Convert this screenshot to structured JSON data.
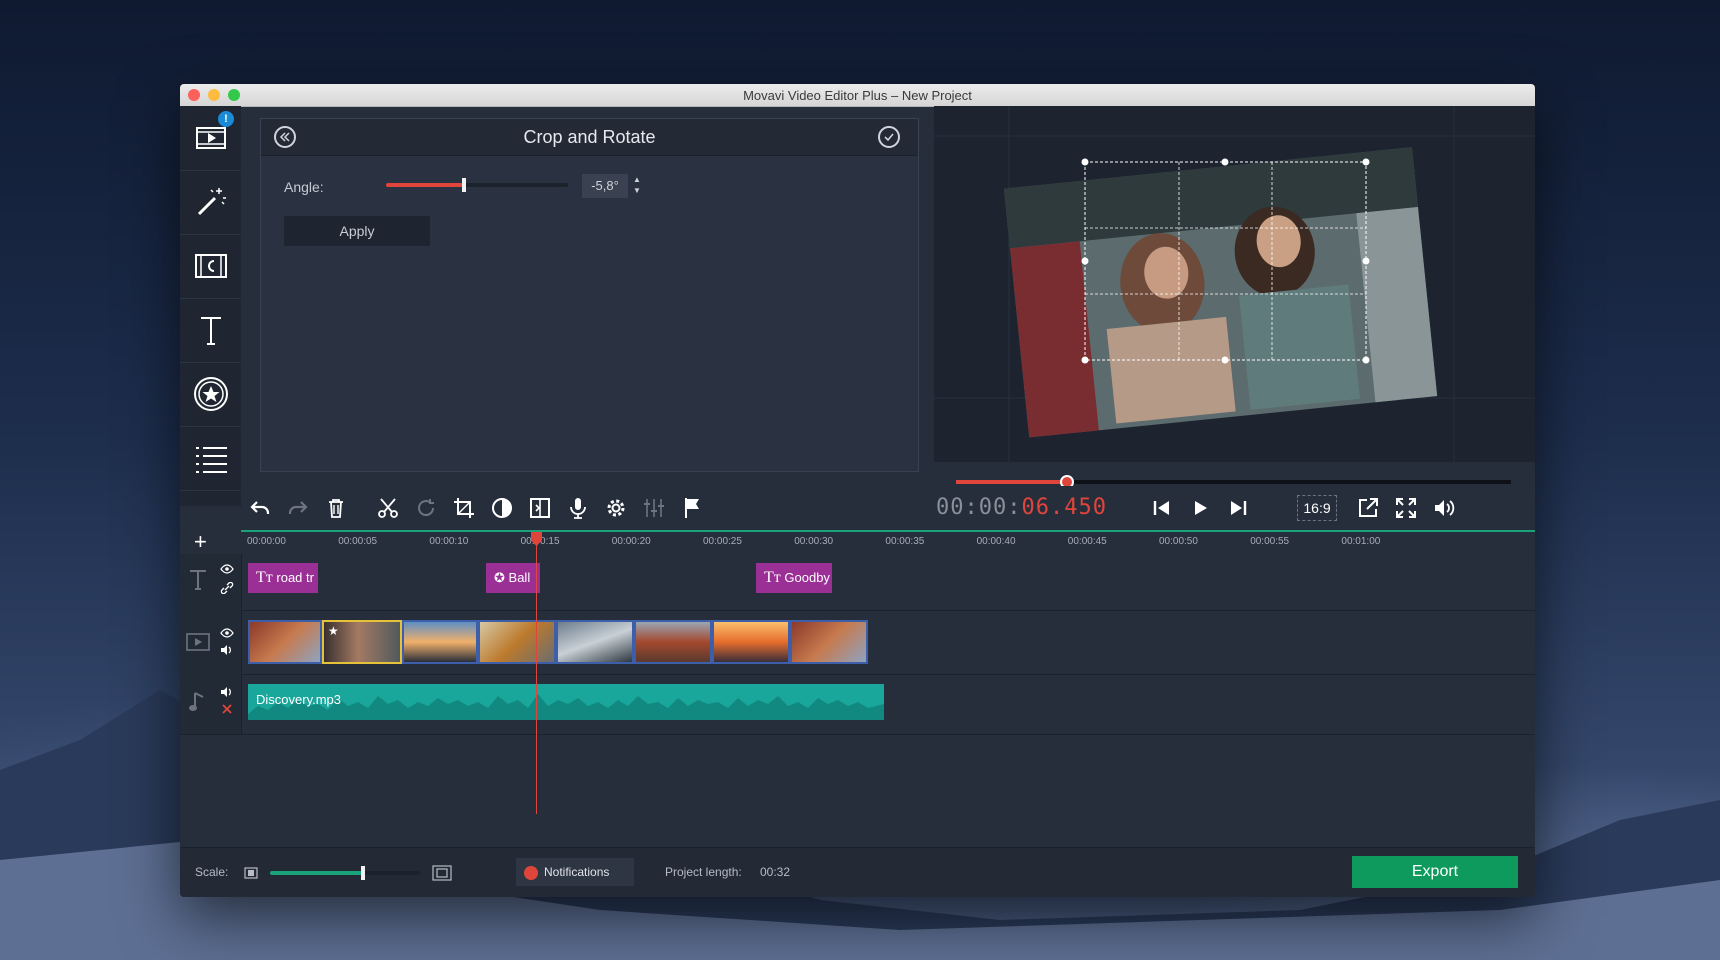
{
  "window": {
    "title": "Movavi Video Editor Plus – New Project"
  },
  "sidebar": {
    "items": [
      {
        "name": "import",
        "icon": "film-import-icon",
        "badge": "!"
      },
      {
        "name": "filters",
        "icon": "magic-wand-icon"
      },
      {
        "name": "transitions",
        "icon": "transition-film-icon"
      },
      {
        "name": "titles",
        "icon": "text-icon"
      },
      {
        "name": "stickers",
        "icon": "star-sticker-icon"
      },
      {
        "name": "more",
        "icon": "list-icon"
      }
    ]
  },
  "panel": {
    "title": "Crop and Rotate",
    "angle_label": "Angle:",
    "angle_value": "-5,8°",
    "angle_fraction": 0.43,
    "apply_label": "Apply"
  },
  "player": {
    "progress_fraction": 0.2,
    "timecode_dim": "00:00:",
    "timecode_red": "06.450",
    "aspect": "16:9"
  },
  "timeline": {
    "ticks": [
      "00:00:00",
      "00:00:05",
      "00:00:10",
      "00:00:15",
      "00:00:20",
      "00:00:25",
      "00:00:30",
      "00:00:35",
      "00:00:40",
      "00:00:45",
      "00:00:50",
      "00:00:55",
      "00:01:00"
    ],
    "titles": [
      {
        "text": "road tr",
        "icon": "text-icon"
      },
      {
        "text": "Ball",
        "icon": "sticker-icon"
      },
      {
        "text": "Goodby",
        "icon": "text-icon"
      }
    ],
    "audio": {
      "name": "Discovery.mp3"
    }
  },
  "bottom": {
    "scale_label": "Scale:",
    "scale_fraction": 0.62,
    "notifications_label": "Notifications",
    "project_length_label": "Project length:",
    "project_length_value": "00:32",
    "export_label": "Export"
  },
  "colors": {
    "accent_red": "#e0453b",
    "export_green": "#0f9a5d",
    "title_clip": "#9a2f95",
    "audio_teal": "#1aa79b"
  }
}
